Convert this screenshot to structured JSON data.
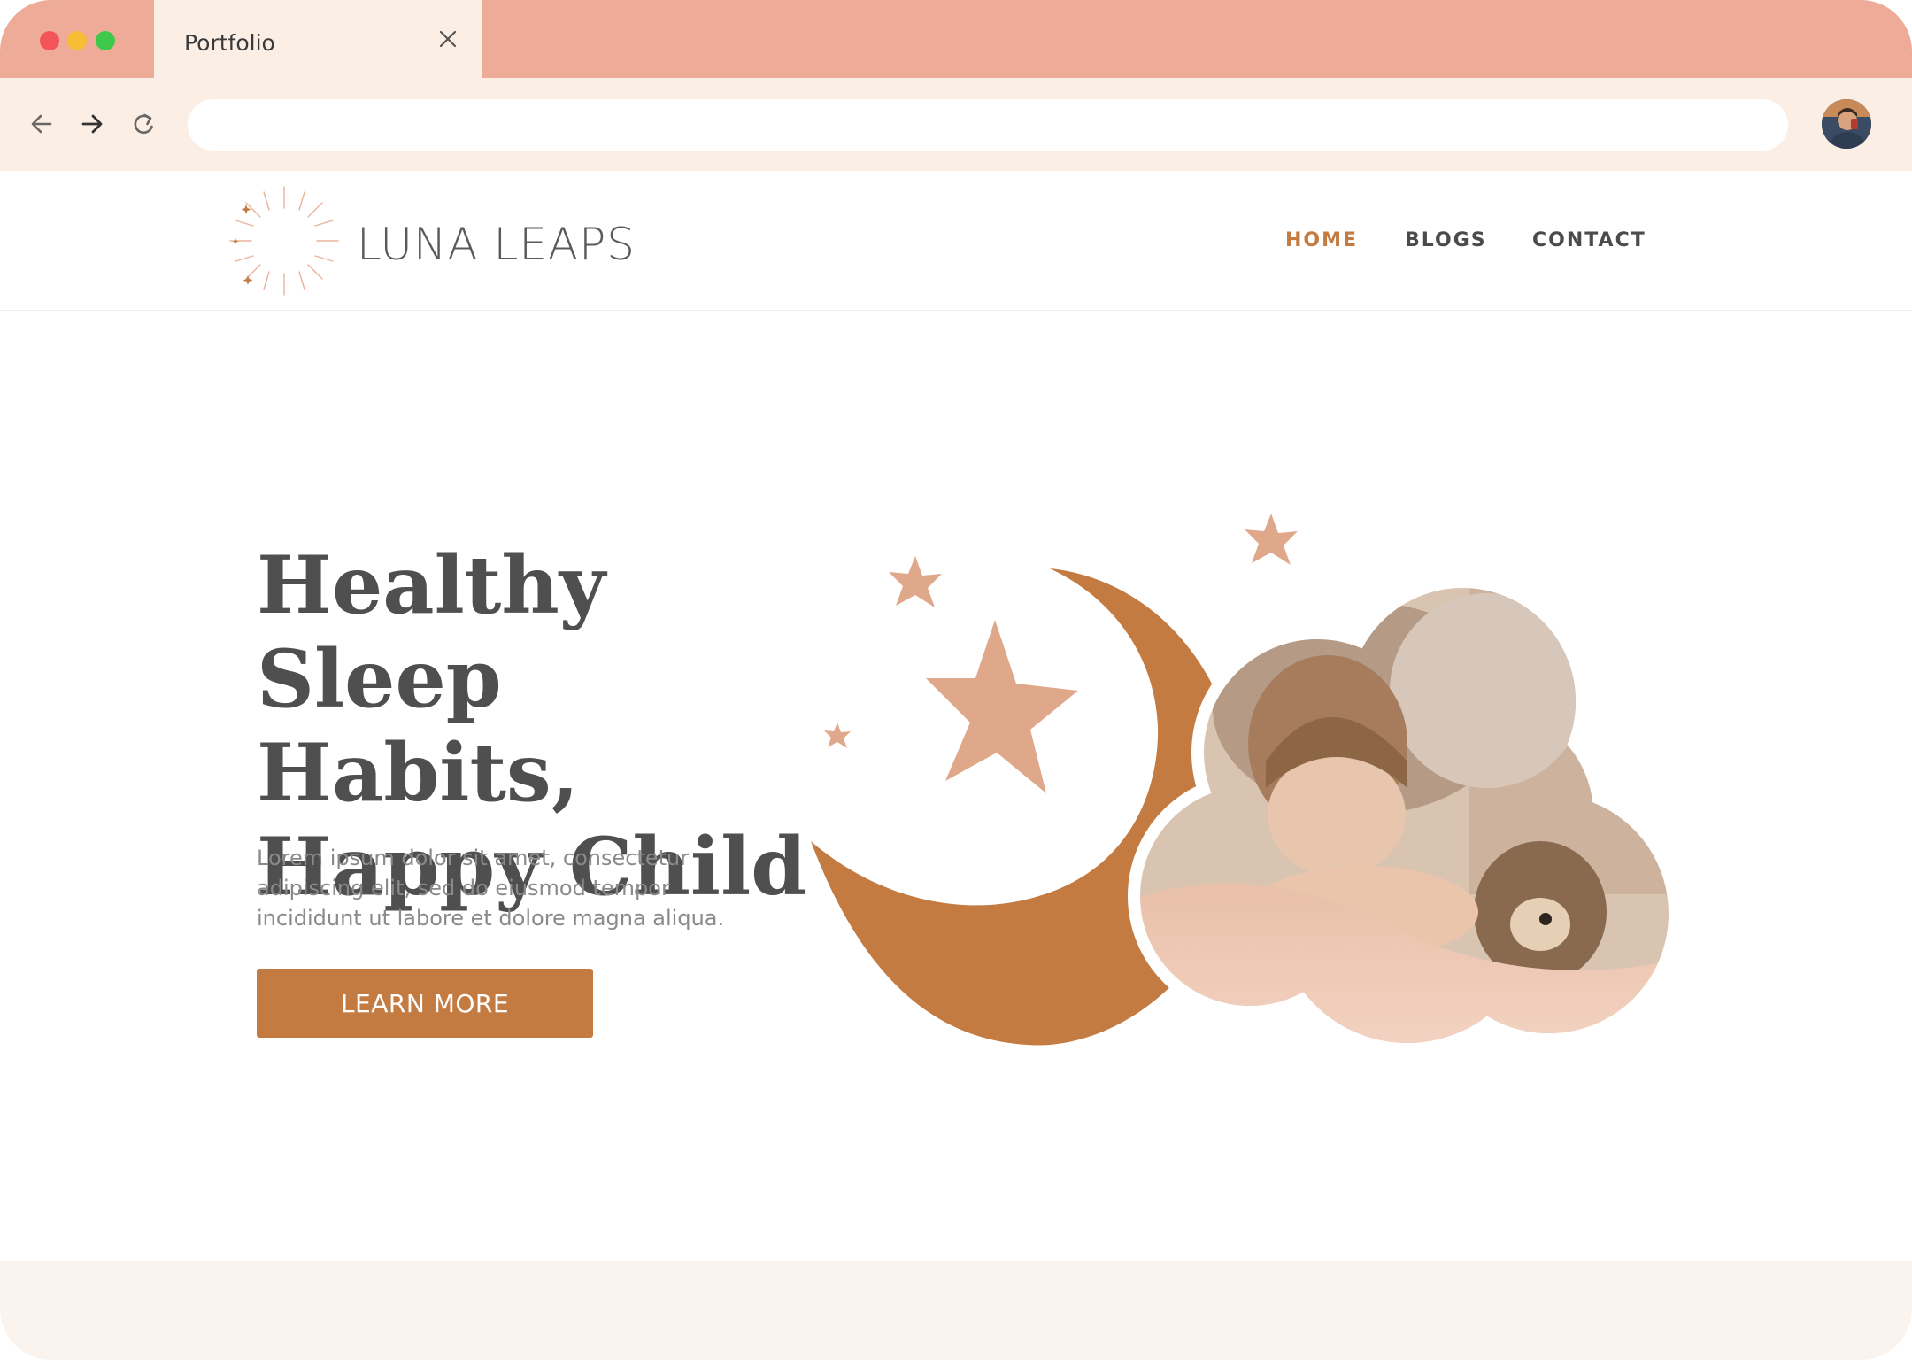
{
  "browser": {
    "tab": {
      "title": "Portfolio"
    },
    "address": {
      "value": "",
      "placeholder": ""
    }
  },
  "site": {
    "logo": {
      "text": "LUNA LEAPS"
    },
    "nav": [
      {
        "label": "HOME",
        "active": true
      },
      {
        "label": "BLOGS",
        "active": false
      },
      {
        "label": "CONTACT",
        "active": false
      }
    ]
  },
  "hero": {
    "title_lines": [
      "Healthy Sleep",
      "Habits,",
      "Happy Child"
    ],
    "copy": "Lorem ipsum dolor sit amet, consectetur adipiscing elit, sed do eiusmod tempor incididunt ut labore et dolore magna aliqua.",
    "button_label": "LEARN MORE"
  },
  "colors": {
    "tab_bar": "#eeac98",
    "toolbar": "#fbeee4",
    "accent": "#c47b41",
    "star": "#e0a88b",
    "text_dark": "#4f4f4f"
  },
  "icons": [
    "back-arrow-icon",
    "forward-arrow-icon",
    "reload-icon",
    "close-icon",
    "moon-logo-icon",
    "moon-icon",
    "star-icon"
  ]
}
